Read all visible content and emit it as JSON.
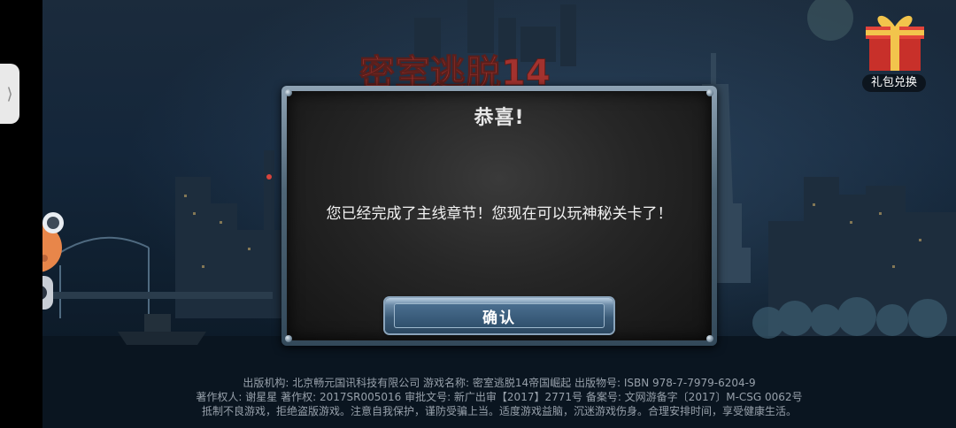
{
  "screen": {
    "background_color": "#0c1a2a"
  },
  "game": {
    "title_logo": "密室逃脱14"
  },
  "gift": {
    "label": "礼包兑换"
  },
  "side_handle": {
    "glyph": "⟩"
  },
  "dialog": {
    "title": "恭喜!",
    "message": "您已经完成了主线章节！您现在可以玩神秘关卡了！",
    "confirm_label": "确认"
  },
  "footer": {
    "line1": "出版机构: 北京畅元国讯科技有限公司   游戏名称: 密室逃脱14帝国崛起   出版物号: ISBN 978-7-7979-6204-9",
    "line2": "著作权人: 谢星星   著作权: 2017SR005016   审批文号: 新广出审【2017】2771号   备案号: 文网游备字〔2017〕M-CSG 0062号",
    "line3": "抵制不良游戏，拒绝盗版游戏。注意自我保护，谨防受骗上当。适度游戏益脑，沉迷游戏伤身。合理安排时间，享受健康生活。"
  },
  "colors": {
    "dialog_frame": "#4f6677",
    "dialog_body": "#262626",
    "button": "#3b5b78",
    "logo_red": "#a3322e"
  }
}
